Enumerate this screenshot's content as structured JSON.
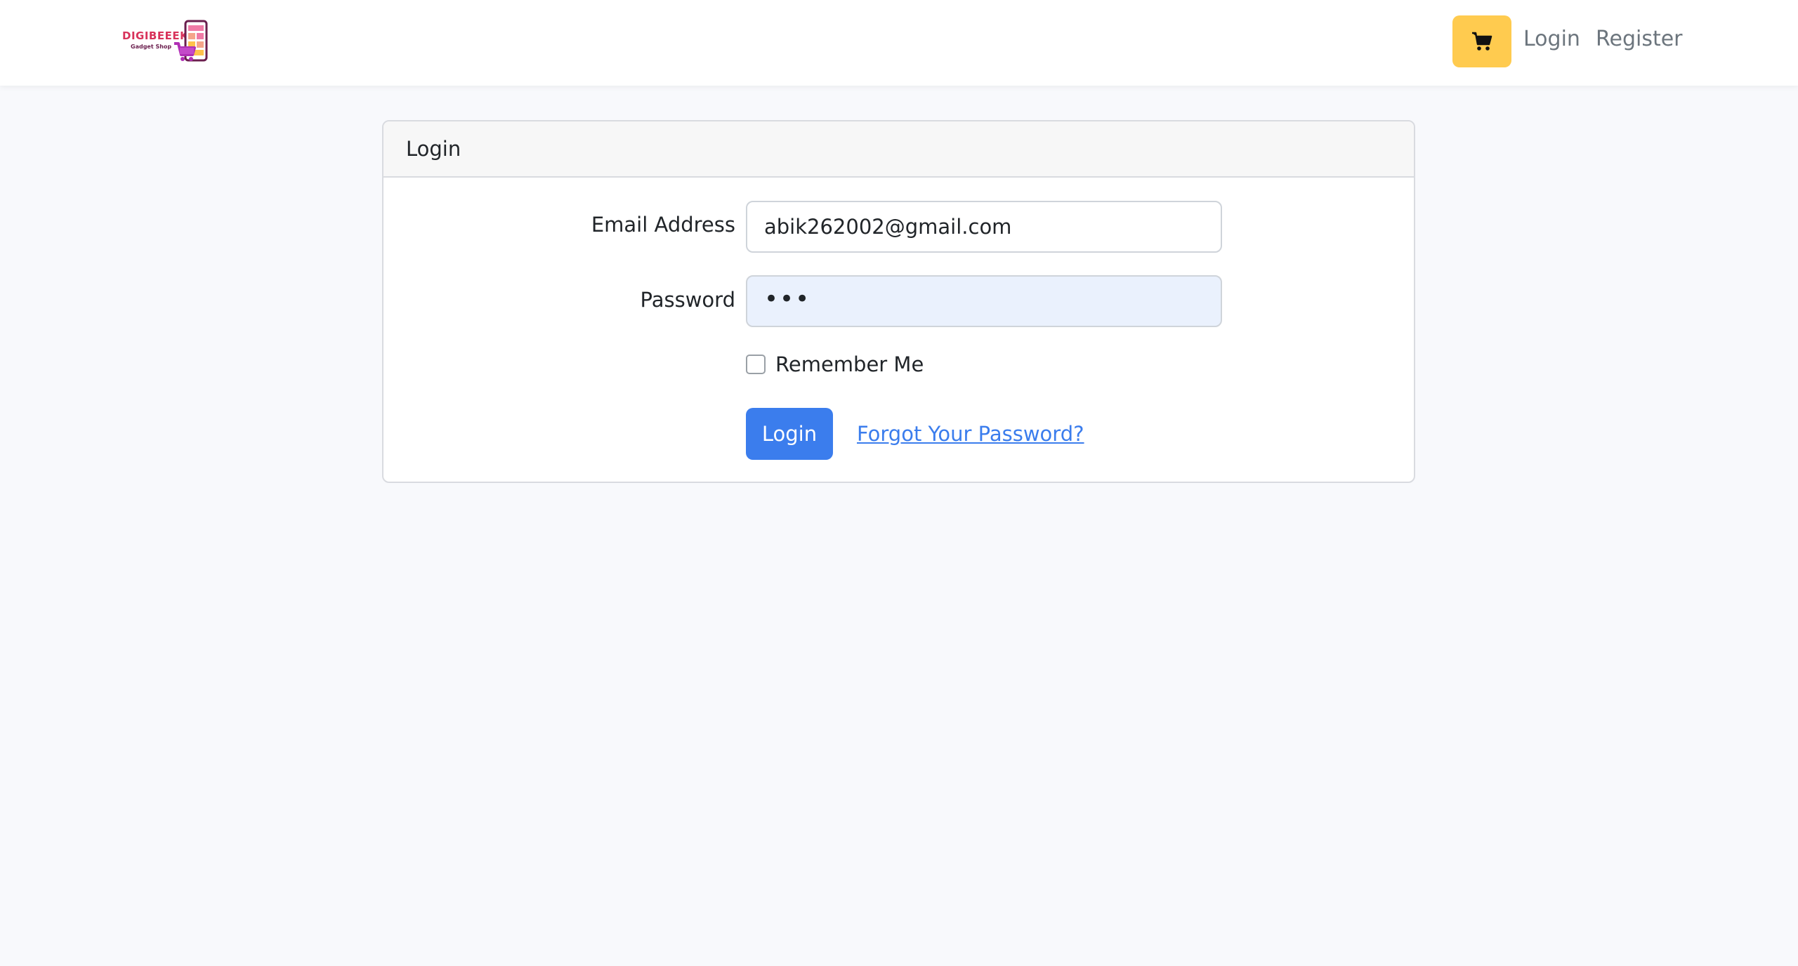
{
  "navbar": {
    "logo": {
      "brand": "DIGIBEEEK",
      "tagline": "Gadget Shop"
    },
    "cart_icon": "shopping-cart-icon",
    "links": {
      "login": "Login",
      "register": "Register"
    }
  },
  "login_card": {
    "header_title": "Login",
    "email_label": "Email Address",
    "email_value": "abik262002@gmail.com",
    "password_label": "Password",
    "password_value": "•••",
    "remember_label": "Remember Me",
    "remember_checked": false,
    "submit_label": "Login",
    "forgot_label": "Forgot Your Password?"
  },
  "colors": {
    "cart_button": "#ffcb4f",
    "primary": "#3b7ded",
    "password_autofill_bg": "#eaf1fd",
    "brand_red": "#d8325a"
  }
}
